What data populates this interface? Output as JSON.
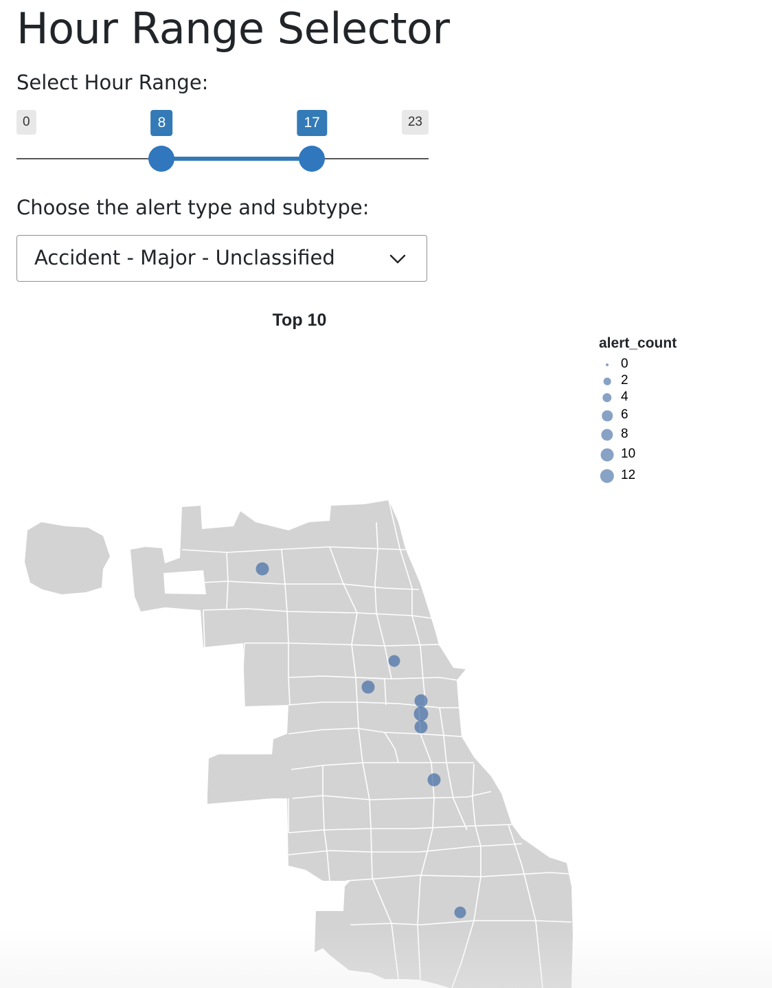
{
  "page": {
    "title": "Hour Range Selector"
  },
  "hour_range": {
    "label": "Select Hour Range:",
    "min": 0,
    "max": 23,
    "from": 8,
    "to": 17,
    "min_label": "0",
    "max_label": "23",
    "from_label": "8",
    "to_label": "17",
    "accent_color": "#337ab7"
  },
  "alert_select": {
    "label": "Choose the alert type and subtype:",
    "value": "Accident - Major - Unclassified"
  },
  "chart": {
    "title": "Top 10",
    "legend_title": "alert_count",
    "legend_items": [
      {
        "label": "0",
        "value": 0
      },
      {
        "label": "2",
        "value": 2
      },
      {
        "label": "4",
        "value": 4
      },
      {
        "label": "6",
        "value": 6
      },
      {
        "label": "8",
        "value": 8
      },
      {
        "label": "10",
        "value": 10
      },
      {
        "label": "12",
        "value": 12
      }
    ],
    "map_fill": "#d3d3d3",
    "map_stroke": "#ffffff",
    "point_color": "#4770a6"
  }
}
